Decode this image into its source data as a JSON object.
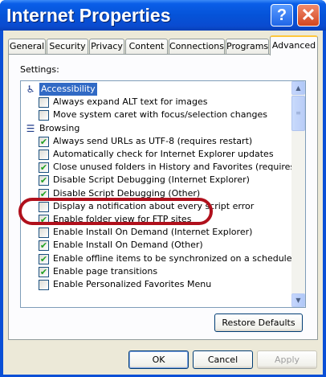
{
  "window": {
    "title": "Internet Properties",
    "help_glyph": "?",
    "close_glyph": "✕"
  },
  "tabs": [
    "General",
    "Security",
    "Privacy",
    "Content",
    "Connections",
    "Programs",
    "Advanced"
  ],
  "active_tab": "Advanced",
  "settings_label": "Settings:",
  "rows": [
    {
      "kind": "category",
      "icon": "accessibility-icon",
      "label": "Accessibility",
      "selected": true
    },
    {
      "kind": "option",
      "checked": false,
      "label": "Always expand ALT text for images"
    },
    {
      "kind": "option",
      "checked": false,
      "label": "Move system caret with focus/selection changes"
    },
    {
      "kind": "category",
      "icon": "browsing-icon",
      "label": "Browsing",
      "selected": false
    },
    {
      "kind": "option",
      "checked": true,
      "label": "Always send URLs as UTF-8 (requires restart)"
    },
    {
      "kind": "option",
      "checked": false,
      "label": "Automatically check for Internet Explorer updates"
    },
    {
      "kind": "option",
      "checked": true,
      "label": "Close unused folders in History and Favorites (requires restart)"
    },
    {
      "kind": "option",
      "checked": true,
      "label": "Disable Script Debugging (Internet Explorer)"
    },
    {
      "kind": "option",
      "checked": true,
      "label": "Disable Script Debugging (Other)"
    },
    {
      "kind": "option",
      "checked": false,
      "label": "Display a notification about every script error"
    },
    {
      "kind": "option",
      "checked": true,
      "label": "Enable folder view for FTP sites"
    },
    {
      "kind": "option",
      "checked": false,
      "label": "Enable Install On Demand (Internet Explorer)"
    },
    {
      "kind": "option",
      "checked": true,
      "label": "Enable Install On Demand (Other)"
    },
    {
      "kind": "option",
      "checked": true,
      "label": "Enable offline items to be synchronized on a schedule"
    },
    {
      "kind": "option",
      "checked": true,
      "label": "Enable page transitions"
    },
    {
      "kind": "option",
      "checked": false,
      "label": "Enable Personalized Favorites Menu"
    }
  ],
  "restore_label": "Restore Defaults",
  "footer": {
    "ok": "OK",
    "cancel": "Cancel",
    "apply": "Apply"
  },
  "colors": {
    "highlight": "#316ac5",
    "annotation": "#b0101c",
    "title_bar": "#0553d8"
  }
}
